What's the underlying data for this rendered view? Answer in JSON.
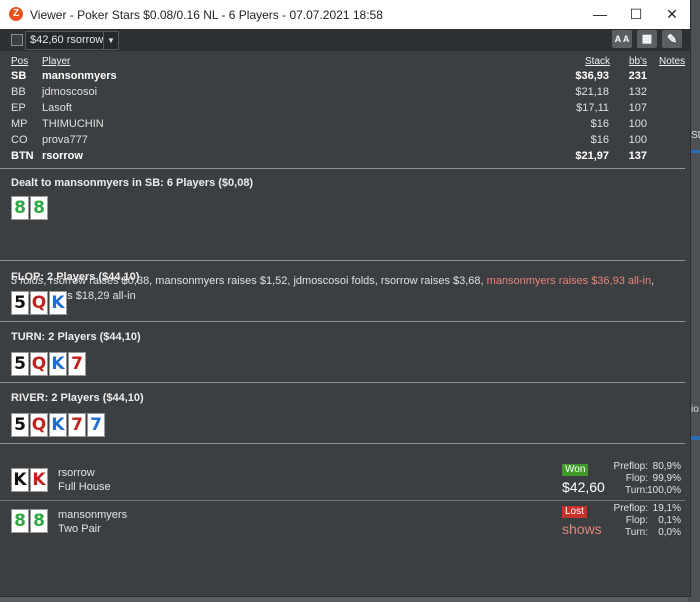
{
  "window": {
    "title": "Viewer - Poker Stars $0.08/0.16 NL - 6 Players - 07.07.2021 18:58",
    "minimize": "—",
    "maximize": "☐",
    "close": "✕"
  },
  "toolbar": {
    "hand_select": "$42,60 rsorrow",
    "font_btn": "A A",
    "grid_btn": "▦",
    "edit_btn": "✎"
  },
  "table": {
    "headers": {
      "pos": "Pos",
      "player": "Player",
      "stack": "Stack",
      "bbs": "bb's",
      "notes": "Notes"
    },
    "rows": [
      {
        "pos": "SB",
        "player": "mansonmyers",
        "stack": "$36,93",
        "bbs": "231",
        "bold": true
      },
      {
        "pos": "BB",
        "player": "jdmoscosoi",
        "stack": "$21,18",
        "bbs": "132",
        "bold": false
      },
      {
        "pos": "EP",
        "player": "Lasoft",
        "stack": "$17,11",
        "bbs": "107",
        "bold": false
      },
      {
        "pos": "MP",
        "player": "THIMUCHIN",
        "stack": "$16",
        "bbs": "100",
        "bold": false
      },
      {
        "pos": "CO",
        "player": "prova777",
        "stack": "$16",
        "bbs": "100",
        "bold": false
      },
      {
        "pos": "BTN",
        "player": "rsorrow",
        "stack": "$21,97",
        "bbs": "137",
        "bold": true
      }
    ]
  },
  "preflop": {
    "title": "Dealt to mansonmyers in SB: 6 Players ($0,08)",
    "cards": [
      {
        "rank": "8",
        "suit": "c"
      },
      {
        "rank": "8",
        "suit": "c"
      }
    ],
    "action_folds": "3 folds",
    "action_mid": ", rsorrow raises $0,38, mansonmyers raises $1,52, jdmoscosoi folds, rsorrow raises $3,68, ",
    "action_allin": "mansonmyers raises $36,93 all-in",
    "action_end": ", rsorrow calls $18,29 all-in"
  },
  "flop": {
    "title": "FLOP: 2 Players ($44,10)",
    "cards": [
      {
        "rank": "5",
        "suit": "s"
      },
      {
        "rank": "Q",
        "suit": "h"
      },
      {
        "rank": "K",
        "suit": "d"
      }
    ]
  },
  "turn": {
    "title": "TURN: 2 Players ($44,10)",
    "cards": [
      {
        "rank": "5",
        "suit": "s"
      },
      {
        "rank": "Q",
        "suit": "h"
      },
      {
        "rank": "K",
        "suit": "d"
      },
      {
        "rank": "7",
        "suit": "h"
      }
    ]
  },
  "river": {
    "title": "RIVER: 2 Players ($44,10)",
    "cards": [
      {
        "rank": "5",
        "suit": "s"
      },
      {
        "rank": "Q",
        "suit": "h"
      },
      {
        "rank": "K",
        "suit": "d"
      },
      {
        "rank": "7",
        "suit": "h"
      },
      {
        "rank": "7",
        "suit": "d"
      }
    ]
  },
  "results": [
    {
      "cards": [
        {
          "rank": "K",
          "suit": "s"
        },
        {
          "rank": "K",
          "suit": "h"
        }
      ],
      "name": "rsorrow",
      "hand": "Full House",
      "badge": "Won",
      "badge_color": "#3f9a2b",
      "amount": "$42,60",
      "amount_color": "#ffffff",
      "stats": [
        {
          "label": "Preflop:",
          "value": "80,9%"
        },
        {
          "label": "Flop:",
          "value": "99,9%"
        },
        {
          "label": "Turn:",
          "value": "100,0%"
        }
      ]
    },
    {
      "cards": [
        {
          "rank": "8",
          "suit": "c"
        },
        {
          "rank": "8",
          "suit": "c"
        }
      ],
      "name": "mansonmyers",
      "hand": "Two Pair",
      "badge": "Lost",
      "badge_color": "#c9302c",
      "amount": "shows",
      "amount_color": "#e6837a",
      "stats": [
        {
          "label": "Preflop:",
          "value": "19,1%"
        },
        {
          "label": "Flop:",
          "value": "0,1%"
        },
        {
          "label": "Turn:",
          "value": "0,0%"
        }
      ]
    }
  ],
  "background_peek": {
    "right_text_1": "SD",
    "right_text_2": "io"
  }
}
